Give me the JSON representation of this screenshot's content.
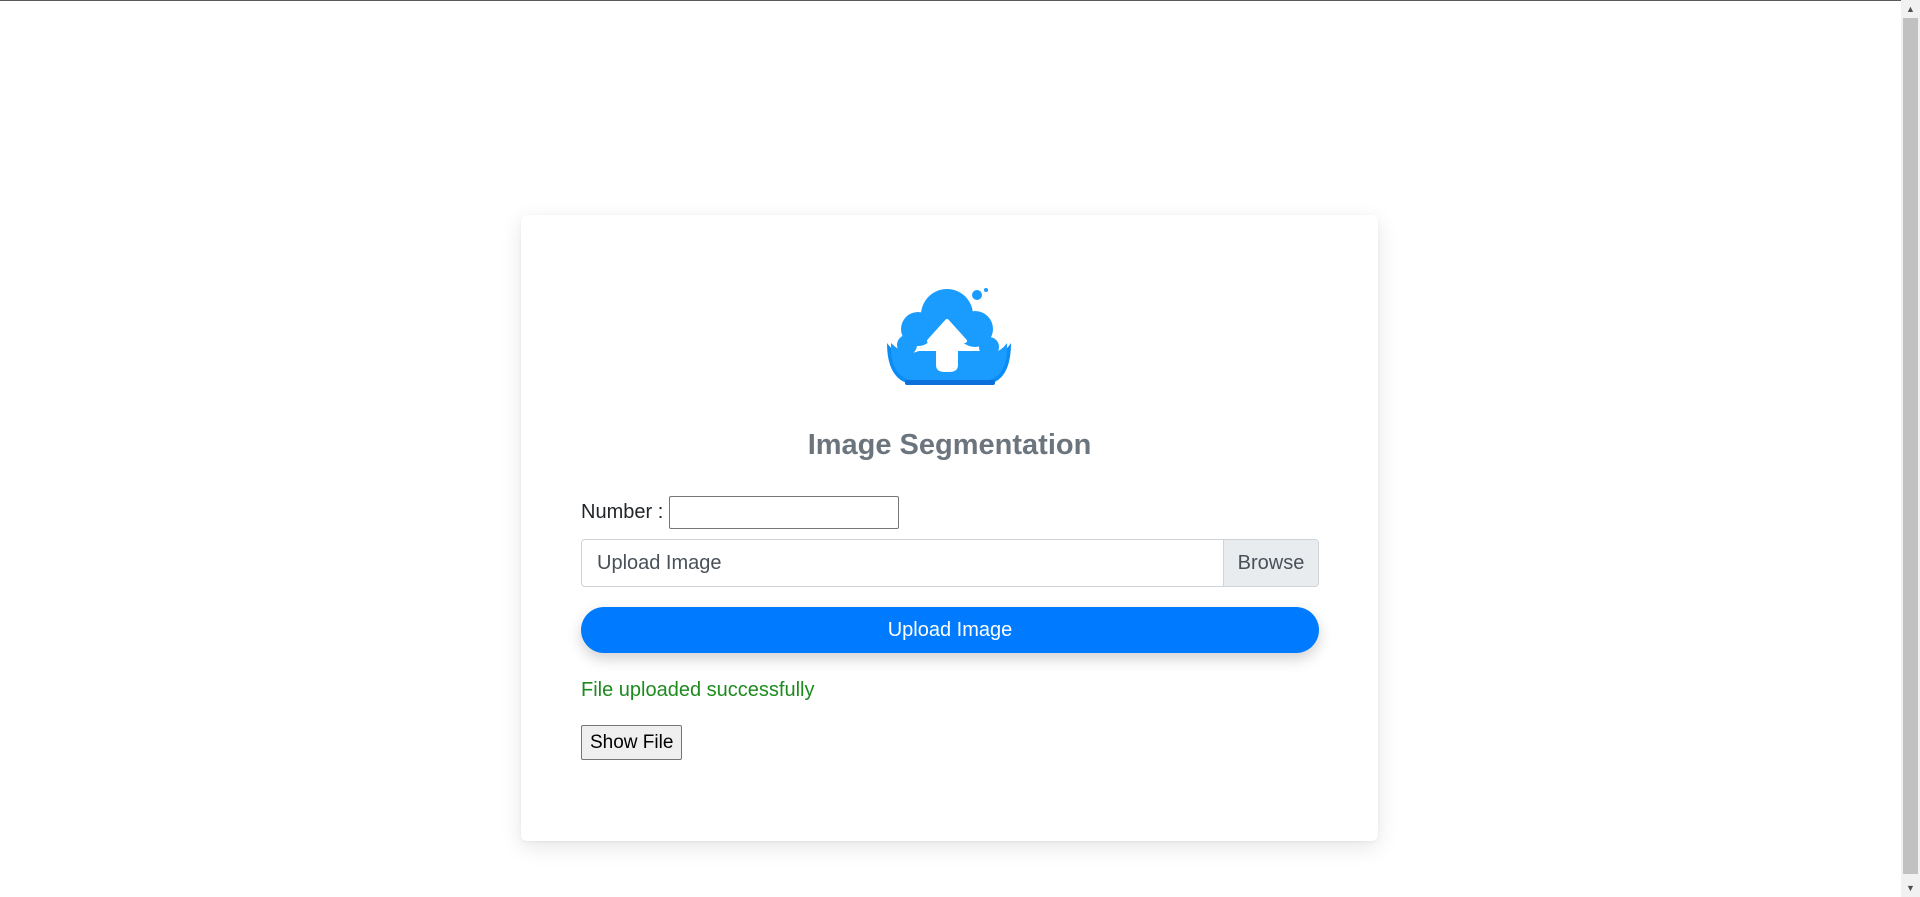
{
  "page": {
    "title": "Image Segmentation"
  },
  "logo": {
    "icon": "cloud-upload-icon",
    "colors": {
      "cloud": "#1a9cff",
      "cloud_dark": "#0a78e6",
      "arrow": "#ffffff"
    }
  },
  "form": {
    "number_label": "Number :",
    "number_value": "",
    "file_placeholder": "Upload Image",
    "browse_label": "Browse",
    "upload_button_label": "Upload Image",
    "status_message": "File uploaded successfully",
    "show_file_label": "Show File"
  },
  "colors": {
    "primary": "#007bff",
    "success_text": "#1e8b1e",
    "title_text": "#6c757d"
  },
  "scrollbar": {
    "up_arrow": "▲",
    "down_arrow": "▼"
  }
}
